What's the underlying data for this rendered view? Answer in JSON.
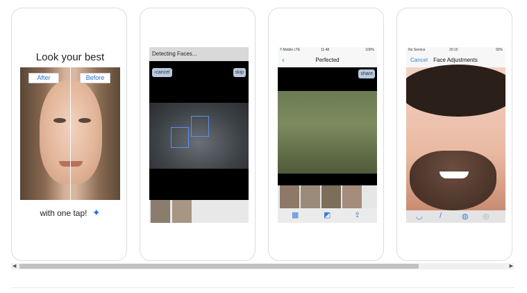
{
  "screens": [
    {
      "title": "Look your best",
      "after_label": "After",
      "before_label": "Before",
      "tagline": "with one tap!",
      "wand_icon": "magic-wand-icon"
    },
    {
      "status": "Detecting Faces...",
      "cancel": "cancel",
      "skip": "skip"
    },
    {
      "carrier": "T-Mobile LTE",
      "time": "11:48",
      "battery": "100%",
      "title": "Perfected",
      "share": "share"
    },
    {
      "carrier": "No Service",
      "time": "20:15",
      "battery": "93%",
      "cancel": "Cancel",
      "title": "Face Adjustments"
    }
  ],
  "colors": {
    "accent": "#3a7fd8",
    "face_box": "#5b8ff0"
  }
}
